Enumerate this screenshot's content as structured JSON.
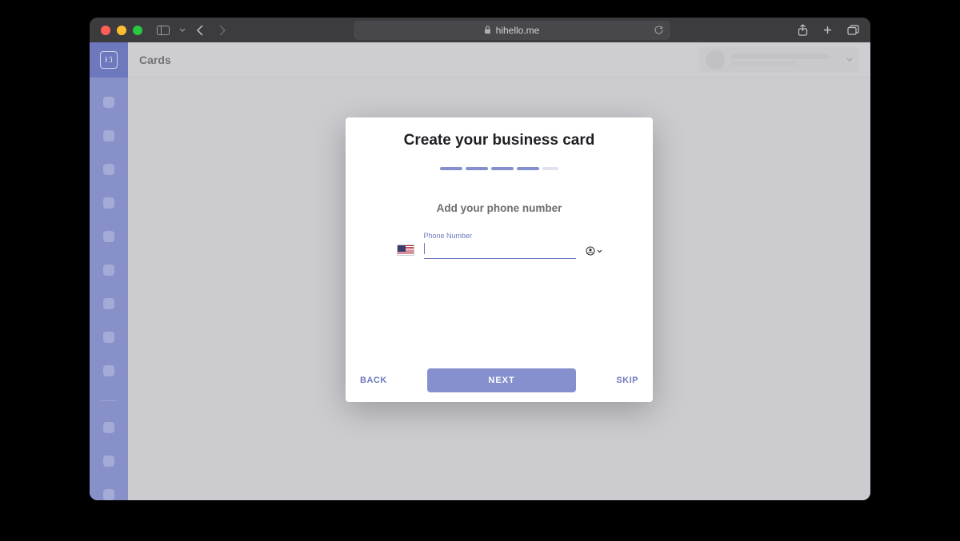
{
  "browser": {
    "url_display": "hihello.me"
  },
  "app": {
    "topbar_title": "Cards",
    "logo_text": "Hi"
  },
  "modal": {
    "title": "Create your business card",
    "subtitle": "Add your phone number",
    "field_label": "Phone Number",
    "field_value": "",
    "country": "us",
    "back_label": "BACK",
    "next_label": "NEXT",
    "skip_label": "SKIP",
    "progress_current": 4,
    "progress_total": 5
  }
}
